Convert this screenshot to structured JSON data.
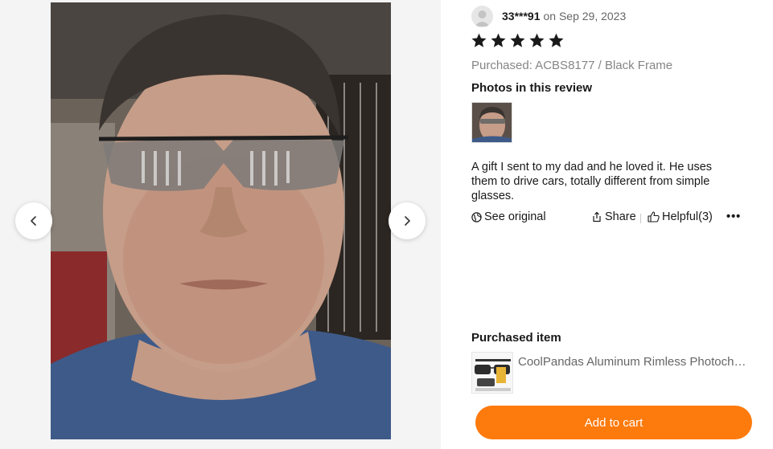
{
  "gallery": {
    "prev_icon": "chevron-left-icon",
    "next_icon": "chevron-right-icon"
  },
  "review": {
    "reviewer_name": "33***91",
    "date": "on Sep 29, 2023",
    "rating": 5,
    "rating_max": 5,
    "purchased_sku": "Purchased: ACBS8177 / Black Frame",
    "photos_heading": "Photos in this review",
    "text": "A gift I sent to my dad and he loved it. He uses them to drive cars, totally different from simple glasses.",
    "actions": {
      "see_original": "See original",
      "share": "Share",
      "helpful": "Helpful(3)",
      "more": "•••"
    }
  },
  "purchased_item": {
    "heading": "Purchased item",
    "title": "CoolPandas Aluminum Rimless Photochromic Polarized Sunglasses"
  },
  "cart": {
    "add_label": "Add to cart"
  },
  "colors": {
    "accent": "#fd7a0c",
    "star": "#191919",
    "muted": "#858585"
  }
}
